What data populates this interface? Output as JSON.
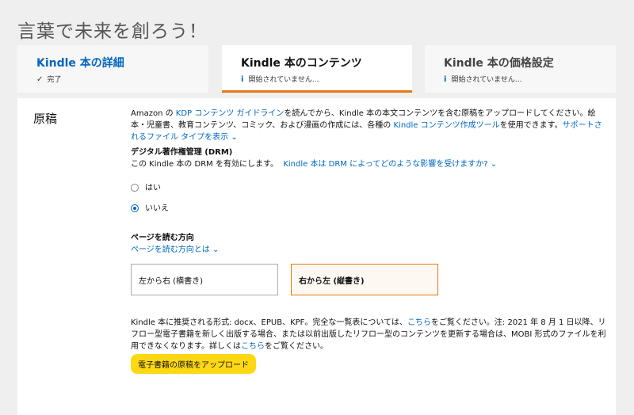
{
  "page": {
    "title": "言葉で未来を創ろう！"
  },
  "tabs": [
    {
      "title": "Kindle 本の詳細",
      "status": "完了",
      "status_icon": "check-icon"
    },
    {
      "title": "Kindle 本のコンテンツ",
      "status": "開始されていません...",
      "status_icon": "info-icon"
    },
    {
      "title": "Kindle 本の価格設定",
      "status": "開始されていません...",
      "status_icon": "info-icon"
    }
  ],
  "manuscript": {
    "label": "原稿",
    "intro_1": "Amazon の ",
    "intro_link_1": "KDP コンテンツ ガイドライン",
    "intro_2": "を読んでから、Kindle 本の本文コンテンツを含む原稿をアップロードしてください。絵本・児童書、教育コンテンツ、コミック、および漫画の作成には、各種の ",
    "intro_link_2": "Kindle コンテンツ作成ツール",
    "intro_3": "を使用できます。",
    "intro_link_3": "サポートされるファイル タイプを表示",
    "drm": {
      "heading": "デジタル著作権管理 (DRM)",
      "text": "この Kindle 本の DRM を有効にします。",
      "link": "Kindle 本は DRM によってどのような影響を受けますか?",
      "options": [
        "はい",
        "いいえ"
      ],
      "selected": "いいえ"
    },
    "direction": {
      "heading": "ページを読む方向",
      "link": "ページを読む方向とは",
      "left_to_right": "左から右 (横書き)",
      "right_to_left": "右から左 (縦書き)",
      "selected": "右から左 (縦書き)"
    },
    "formats": {
      "text_1": "Kindle 本に推奨される形式: docx、EPUB、KPF。完全な一覧表については、",
      "link_1": "こちら",
      "text_2": "をご覧ください。注: 2021 年 8 月 1 日以降、リフロー型電子書籍を新しく出版する場合、または以前出版したリフロー型のコンテンツを更新する場合は、MOBI 形式のファイルを利用できなくなります。詳しくは",
      "link_2": "こちら",
      "text_3": "をご覧ください。"
    },
    "upload_button": "電子書籍の原稿をアップロード"
  },
  "colors": {
    "accent": "#e47911",
    "link": "#0066c0",
    "button": "#ffd814"
  }
}
